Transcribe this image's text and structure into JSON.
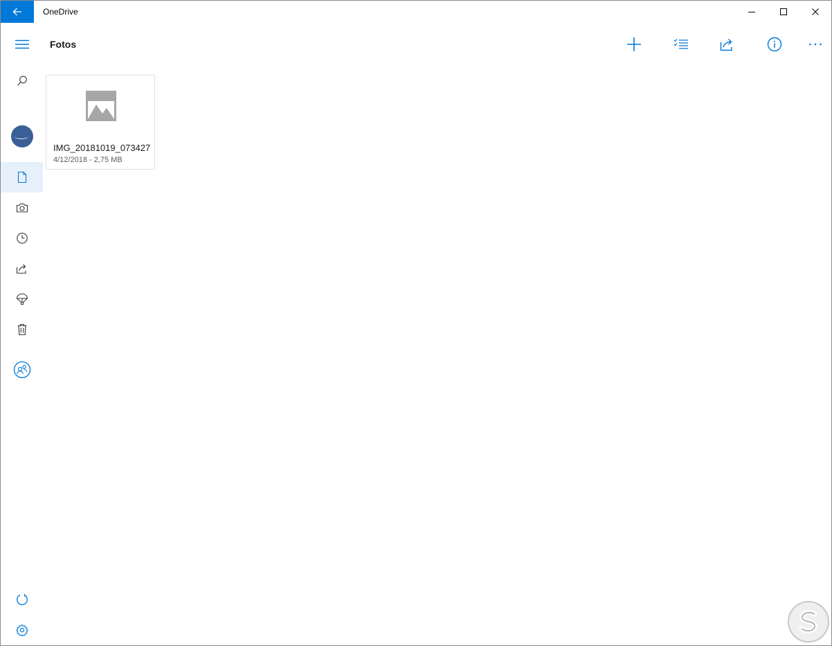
{
  "app": {
    "title": "OneDrive"
  },
  "page": {
    "title": "Fotos"
  },
  "files": [
    {
      "name": "IMG_20181019_073427",
      "meta": "4/12/2018 - 2,75 MB"
    }
  ],
  "colors": {
    "accent": "#0078d7",
    "active_nav": "#e6f0fa",
    "avatar": "#3a5f96"
  },
  "icons": {
    "back": "arrow-left-icon",
    "menu": "hamburger-icon",
    "search": "search-icon",
    "files": "document-icon",
    "photos": "camera-icon",
    "recent": "clock-icon",
    "shared": "share-icon",
    "vault": "parachute-icon",
    "recycle": "trash-icon",
    "people": "people-icon",
    "sync": "sync-icon",
    "settings": "gear-icon",
    "add": "plus-icon",
    "select": "checklist-icon",
    "share": "share-icon",
    "info": "info-icon",
    "more": "more-icon"
  }
}
